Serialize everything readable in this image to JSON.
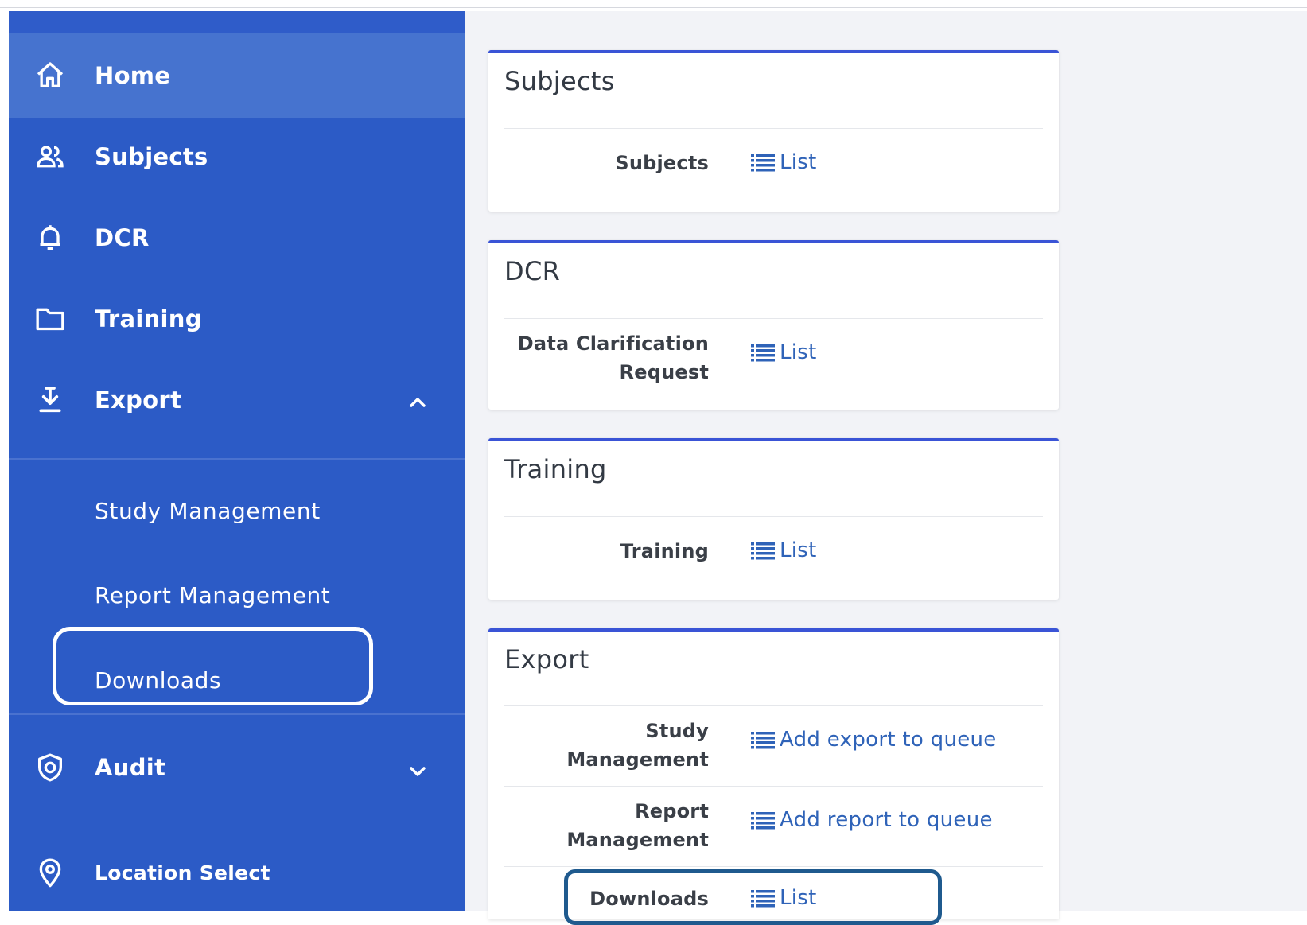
{
  "sidebar": {
    "items": [
      {
        "label": "Home",
        "icon": "home-icon"
      },
      {
        "label": "Subjects",
        "icon": "users-icon"
      },
      {
        "label": "DCR",
        "icon": "bell-icon"
      },
      {
        "label": "Training",
        "icon": "folder-icon"
      },
      {
        "label": "Export",
        "icon": "download-icon"
      },
      {
        "label": "Audit",
        "icon": "shield-icon"
      },
      {
        "label": "Location Select",
        "icon": "location-pin-icon"
      }
    ],
    "export_subitems": [
      {
        "label": "Study Management"
      },
      {
        "label": "Report Management"
      },
      {
        "label": "Downloads"
      }
    ]
  },
  "cards": [
    {
      "title": "Subjects",
      "rows": [
        {
          "label": "Subjects",
          "link": "List"
        }
      ]
    },
    {
      "title": "DCR",
      "rows": [
        {
          "label_line1": "Data Clarification",
          "label_line2": "Request",
          "link": "List"
        }
      ]
    },
    {
      "title": "Training",
      "rows": [
        {
          "label": "Training",
          "link": "List"
        }
      ]
    },
    {
      "title": "Export",
      "rows": [
        {
          "label_line1": "Study",
          "label_line2": "Management",
          "link": "Add export to queue"
        },
        {
          "label_line1": "Report",
          "label_line2": "Management",
          "link": "Add report to queue"
        },
        {
          "label": "Downloads",
          "link": "List"
        }
      ]
    }
  ],
  "colors": {
    "sidebar_bg": "#2c5bc6",
    "sidebar_active": "#4673cf",
    "card_accent": "#3a54d6",
    "link": "#2f63b8",
    "highlight_box": "#1f5a8e"
  }
}
